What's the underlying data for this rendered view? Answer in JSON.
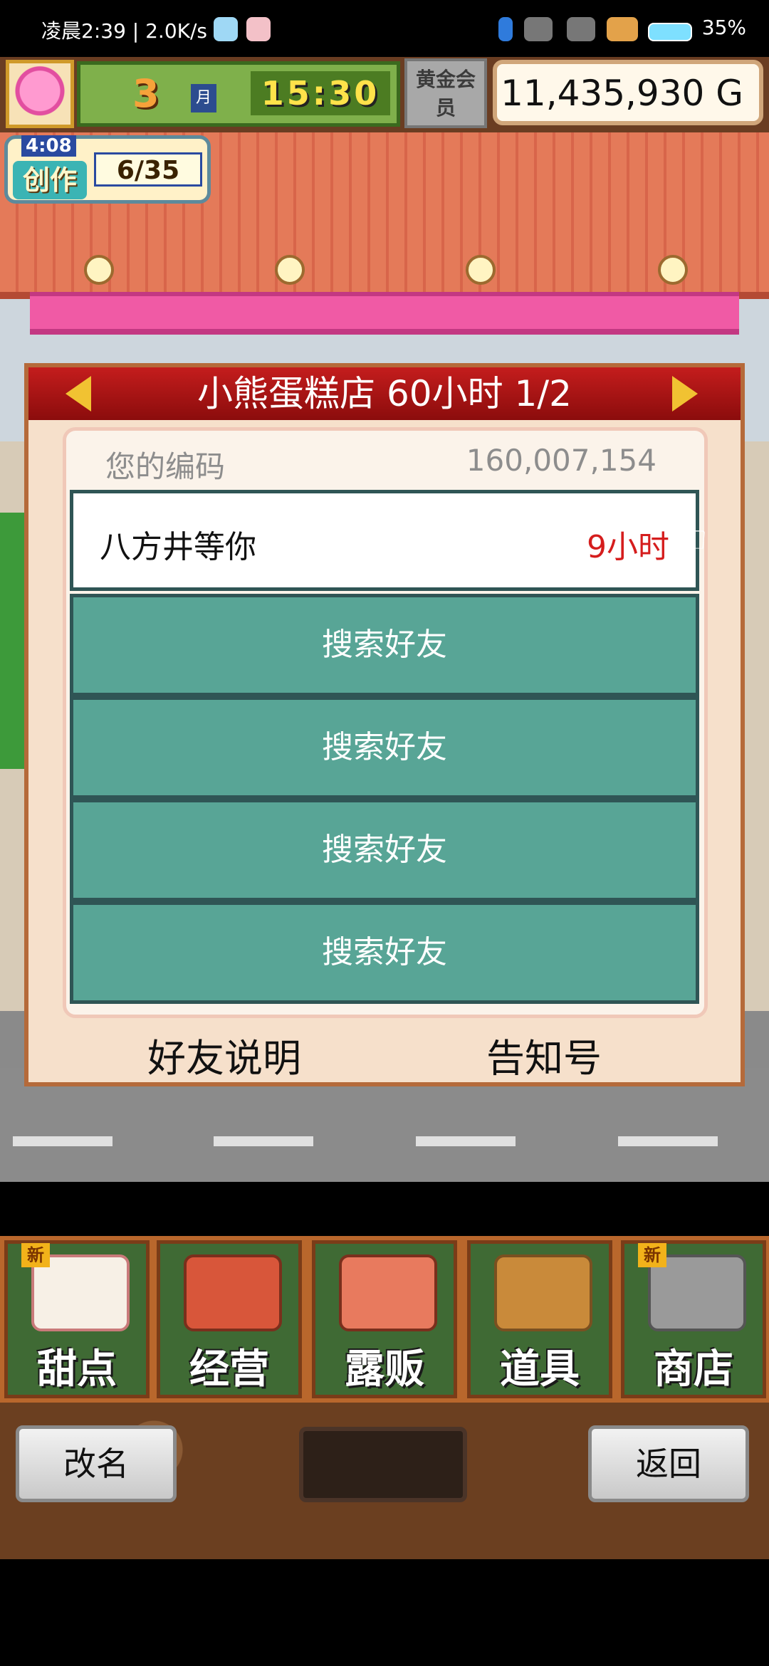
{
  "status_bar": {
    "left_text": "凌晨2:39 | 2.0K/s",
    "right_text": "35%"
  },
  "hud": {
    "month": "3",
    "month_icon_text": "月",
    "time": "15:30",
    "gold_badge": "黄金会员",
    "money": "11,435,930 G"
  },
  "creation": {
    "timer": "4:08",
    "label": "创作",
    "count": "6/35"
  },
  "dialog": {
    "title": "小熊蛋糕店  60小时 1/2",
    "code_label": "您的编码",
    "code_value": "160,007,154",
    "friend": {
      "name": "八方井等你",
      "time": "9小时"
    },
    "search_buttons": [
      "搜索好友",
      "搜索好友",
      "搜索好友",
      "搜索好友"
    ],
    "footer_left": "好友说明",
    "footer_right": "告知号"
  },
  "menu": {
    "items": [
      {
        "label": "甜点",
        "icon": "cake-icon",
        "new": "新"
      },
      {
        "label": "经营",
        "icon": "shop-icon"
      },
      {
        "label": "露贩",
        "icon": "food-truck-icon"
      },
      {
        "label": "道具",
        "icon": "items-bag-icon"
      },
      {
        "label": "商店",
        "icon": "cart-icon",
        "new": "新"
      }
    ]
  },
  "bottom_bar": {
    "rename": "改名",
    "back": "返回"
  },
  "colors": {
    "dialog_header": "#a8121a",
    "search_button": "#58a596",
    "friend_time": "#d51d1d"
  }
}
